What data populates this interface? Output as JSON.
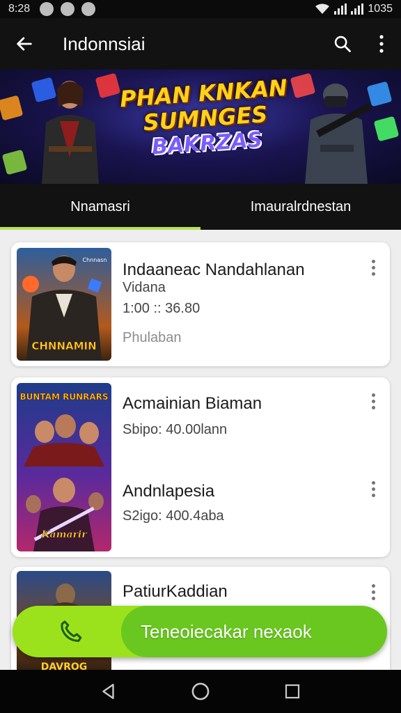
{
  "status_bar": {
    "time": "8:28",
    "clock_right": "1035"
  },
  "app_bar": {
    "title": "Indonnsiai",
    "back_icon": "arrow-left-icon",
    "search_icon": "search-icon",
    "menu_icon": "more-vert-icon"
  },
  "banner": {
    "line1": "PHAN KNKAN",
    "line2": "SUMNGES",
    "line3": "BAKRZAS",
    "accent": "#ffd21a"
  },
  "tabs": [
    {
      "label": "Nnamasri",
      "active": true
    },
    {
      "label": "Imauralrdnestan",
      "active": false
    }
  ],
  "items": [
    {
      "title": "Indaaneac Nandahlanan",
      "subtitle": "Vidana",
      "detail": "1:00 :: 36.80",
      "meta": "Phulaban",
      "thumb_text": "CHNNAMIN",
      "thumb_badge": "Chnnasn"
    },
    {
      "title": "Acmainian Biaman",
      "detail": "Sbipo: 40.00lann",
      "thumb_text_top": "BUNTAM RUNRARS"
    },
    {
      "title": "Andnlapesia",
      "detail": "S2igo:  400.4aba",
      "thumb_text_bottom": "Kamarir"
    },
    {
      "title": "PatiurKaddian",
      "thumb_text": "DAVROG"
    }
  ],
  "fab": {
    "label": "Teneoiecakar nexaok",
    "icon": "phone-icon",
    "color": "#6ac71f"
  },
  "nav": {
    "back": "nav-back-icon",
    "home": "nav-home-icon",
    "recents": "nav-recents-icon"
  }
}
